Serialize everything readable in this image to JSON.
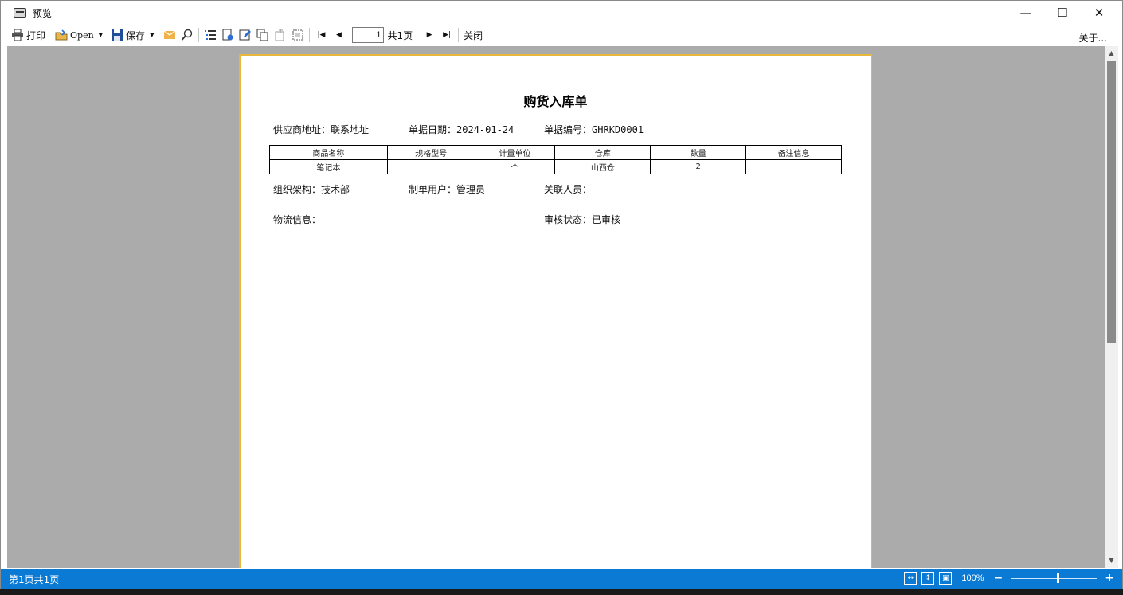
{
  "window": {
    "title": "预览"
  },
  "toolbar": {
    "print_label": "打印",
    "open_label": "Open",
    "save_label": "保存",
    "current_page": "1",
    "total_pages_label": "共1页",
    "close_label": "关闭",
    "about_label": "关于..."
  },
  "document": {
    "title": "购货入库单",
    "supplier_address": {
      "label": "供应商地址：",
      "value": "联系地址"
    },
    "bill_date": {
      "label": "单据日期：",
      "value": "2024-01-24"
    },
    "bill_no": {
      "label": "单据编号：",
      "value": "GHRKD0001"
    },
    "table": {
      "headers": [
        "商品名称",
        "规格型号",
        "计量单位",
        "仓库",
        "数量",
        "备注信息"
      ],
      "rows": [
        [
          "笔记本",
          "",
          "个",
          "山西仓",
          "2",
          ""
        ]
      ]
    },
    "org": {
      "label": "组织架构：",
      "value": "技术部"
    },
    "creator": {
      "label": "制单用户：",
      "value": "管理员"
    },
    "related": {
      "label": "关联人员：",
      "value": ""
    },
    "logistics": {
      "label": "物流信息：",
      "value": ""
    },
    "audit": {
      "label": "审核状态：",
      "value": "已审核"
    }
  },
  "status": {
    "page_info": "第1页共1页",
    "zoom": "100%"
  },
  "colors": {
    "status_bar": "#0a7ad4",
    "paper_border": "#e8b83a",
    "viewport_bg": "#ababab"
  }
}
